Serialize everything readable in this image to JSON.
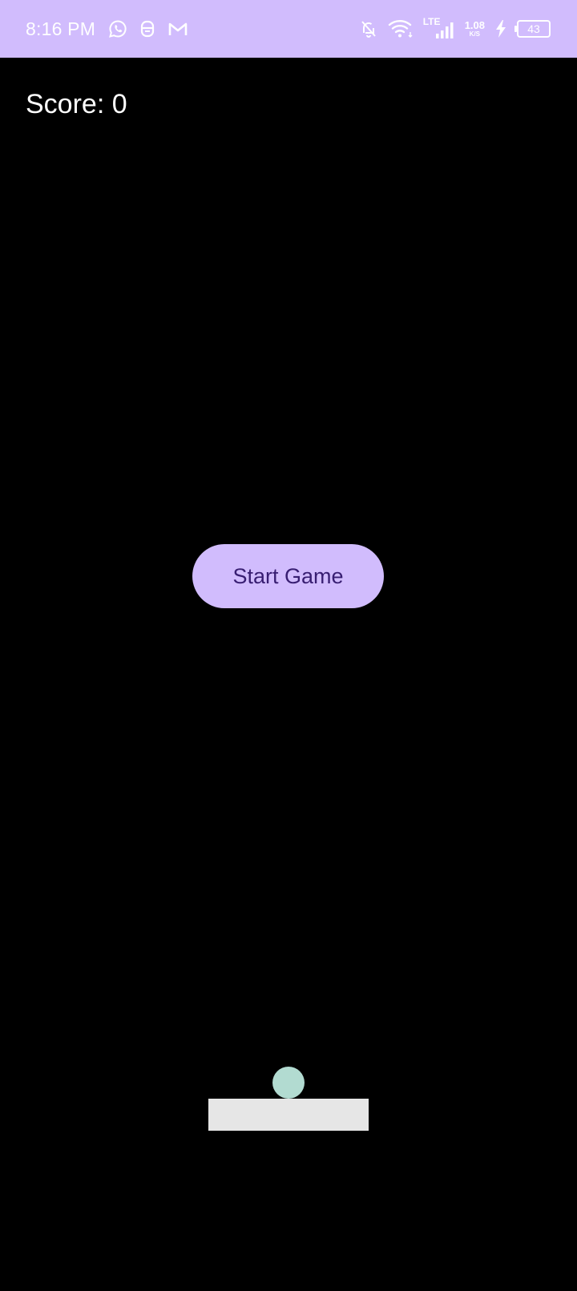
{
  "status_bar": {
    "time": "8:16 PM",
    "network_type": "LTE",
    "speed_value": "1.08",
    "speed_unit": "K/S",
    "battery_level": "43",
    "background_color": "#d1bcfd",
    "icons": [
      "whatsapp-icon",
      "app-notification-icon",
      "gmail-icon",
      "notifications-off-icon",
      "wifi-icon",
      "signal-icon",
      "charging-icon",
      "battery-icon"
    ]
  },
  "game": {
    "score_label": "Score: 0",
    "start_button_label": "Start Game",
    "colors": {
      "background": "#000000",
      "button": "#d1bcfd",
      "button_text": "#381e72",
      "ball": "#b2dbd1",
      "paddle": "#e6e6e6"
    }
  }
}
